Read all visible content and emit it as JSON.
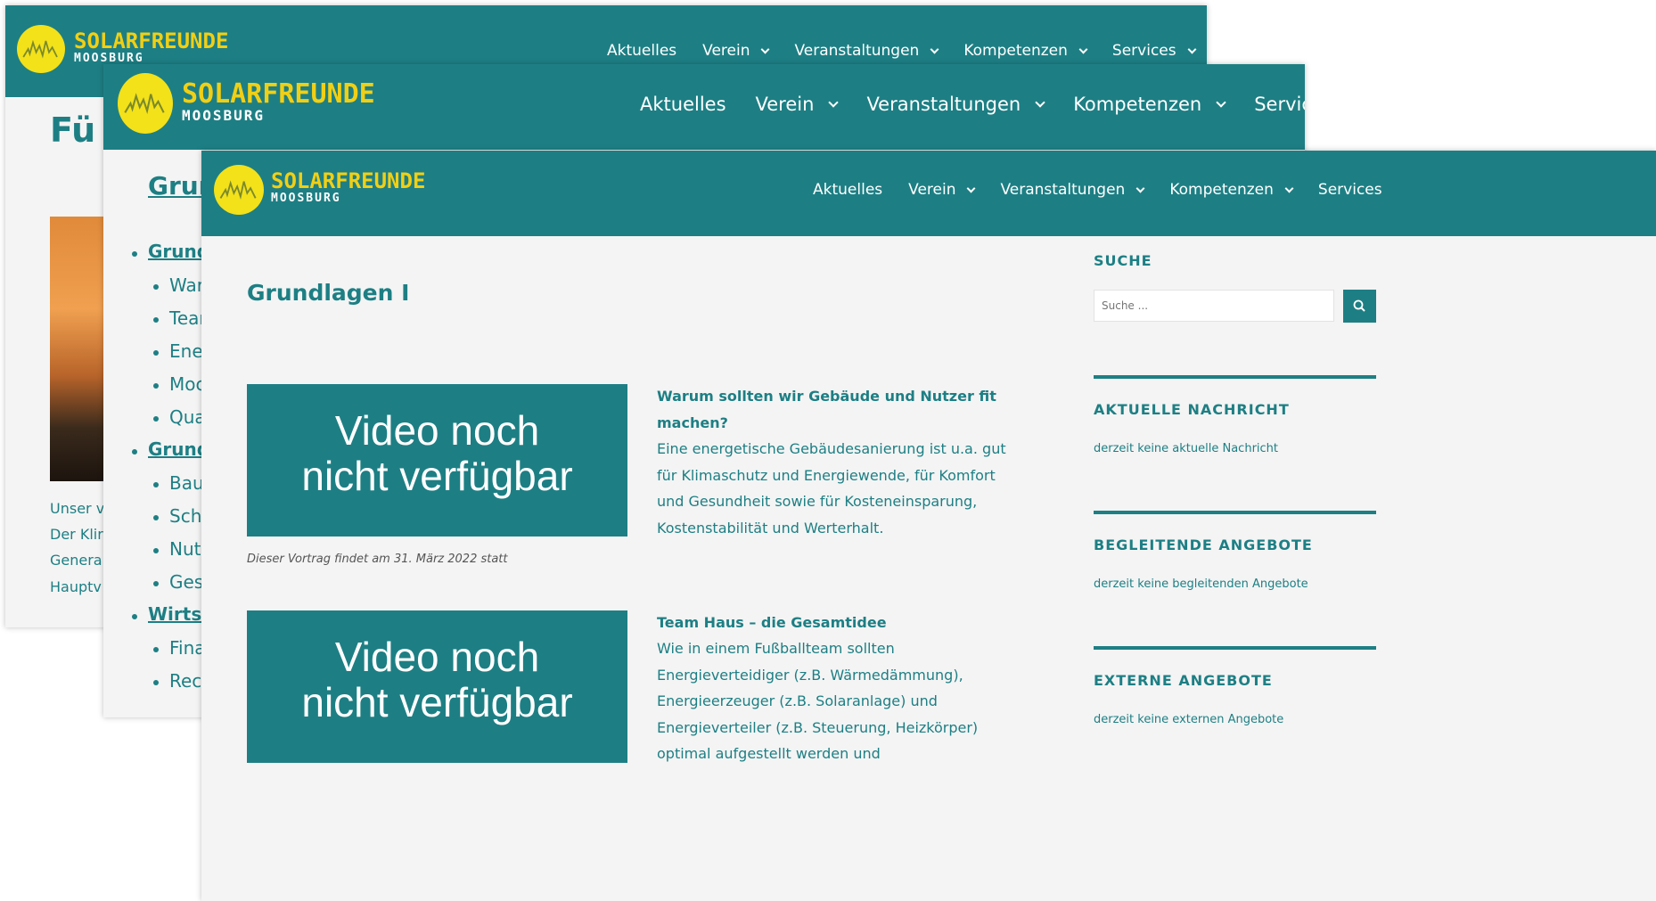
{
  "site": {
    "logo_line1": "SOLARFREUNDE",
    "logo_line2": "MOOSBURG"
  },
  "nav": {
    "items": [
      "Aktuelles",
      "Verein",
      "Veranstaltungen",
      "Kompetenzen",
      "Services"
    ]
  },
  "win1": {
    "heading": "Fü",
    "caption_lines": [
      "Unser v",
      "Der Klir",
      "Genera",
      "Hauptv"
    ]
  },
  "win2": {
    "heading": "Grur",
    "list": [
      {
        "label": "Grund",
        "level": 1
      },
      {
        "label": "War",
        "level": 2
      },
      {
        "label": "Tear",
        "level": 2
      },
      {
        "label": "Ene",
        "level": 2
      },
      {
        "label": "Moc",
        "level": 2
      },
      {
        "label": "Qua",
        "level": 2
      },
      {
        "label": "Grund",
        "level": 1
      },
      {
        "label": "Bau",
        "level": 2
      },
      {
        "label": "Sch",
        "level": 2
      },
      {
        "label": "Nut",
        "level": 2
      },
      {
        "label": "Ges",
        "level": 2
      },
      {
        "label": "Wirts",
        "level": 1
      },
      {
        "label": "Fina",
        "level": 2
      },
      {
        "label": "Rec",
        "level": 2
      }
    ]
  },
  "main": {
    "page_title": "Grundlagen I",
    "video_placeholder": [
      "Video noch",
      "nicht verfügbar"
    ],
    "video_note": "Dieser Vortrag findet am 31. März 2022 statt",
    "article1": {
      "title_lines": [
        "Warum sollten wir Gebäude und Nutzer fit",
        "machen?"
      ],
      "body_lines": [
        "Eine energetische Gebäudesanierung ist u.a. gut",
        "für Klimaschutz und Energiewende, für Komfort",
        "und Gesundheit sowie für Kosteneinsparung,",
        "Kostenstabilität und Werterhalt."
      ]
    },
    "article2": {
      "title": "Team Haus – die Gesamtidee",
      "body_lines": [
        "Wie in einem Fußballteam sollten",
        "Energieverteidiger (z.B. Wärmedämmung),",
        "Energieerzeuger (z.B. Solaranlage) und",
        "Energieverteiler (z.B. Steuerung, Heizkörper)",
        "optimal aufgestellt werden und"
      ]
    }
  },
  "sidebar": {
    "search_heading": "SUCHE",
    "search_placeholder": "Suche ...",
    "news_heading": "AKTUELLE NACHRICHT",
    "news_text": "derzeit keine aktuelle Nachricht",
    "offers_heading": "BEGLEITENDE ANGEBOTE",
    "offers_text": "derzeit keine begleitenden Angebote",
    "external_heading": "EXTERNE ANGEBOTE",
    "external_text": "derzeit keine externen Angebote"
  },
  "colors": {
    "teal": "#1d7f84",
    "yellow": "#f3e11a",
    "background": "#f4f4f4"
  }
}
